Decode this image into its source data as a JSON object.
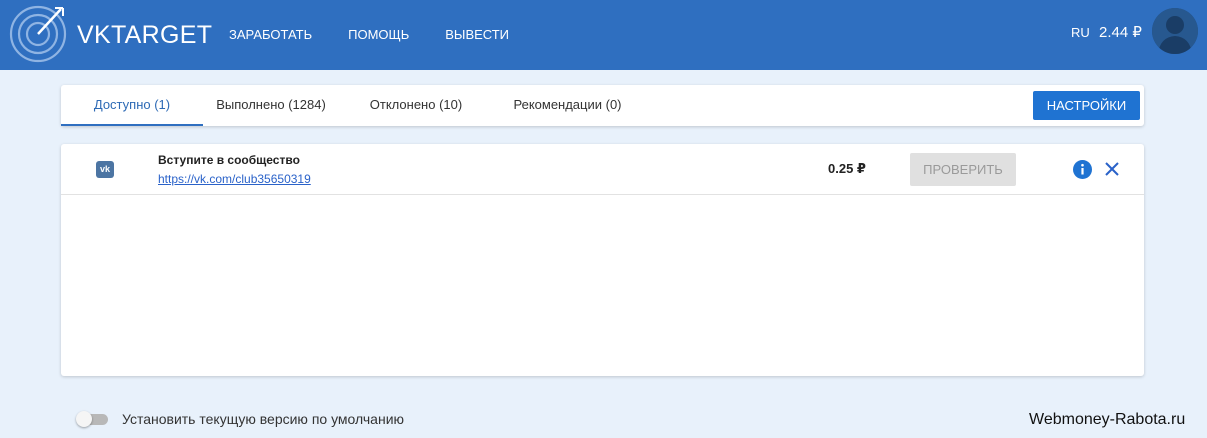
{
  "header": {
    "brand_vk": "VK",
    "brand_target": "TARGET",
    "nav": [
      {
        "label": "ЗАРАБОТАТЬ"
      },
      {
        "label": "ПОМОЩЬ"
      },
      {
        "label": "ВЫВЕСТИ"
      }
    ],
    "lang": "RU",
    "balance": "2.44 ₽",
    "bg_color": "#2f6fc0"
  },
  "tabs": [
    {
      "label": "Доступно (1)",
      "active": true
    },
    {
      "label": "Выполнено (1284)",
      "active": false
    },
    {
      "label": "Отклонено (10)",
      "active": false
    },
    {
      "label": "Рекомендации (0)",
      "active": false
    }
  ],
  "settings_label": "НАСТРОЙКИ",
  "task": {
    "icon": "vk-icon",
    "icon_text": "vk",
    "title": "Вступите в сообщество",
    "link": "https://vk.com/club35650319",
    "price": "0.25 ₽",
    "check_label": "ПРОВЕРИТЬ"
  },
  "footer": {
    "toggle_label": "Установить текущую версию по умолчанию",
    "toggle_on": false,
    "watermark": "Webmoney-Rabota.ru"
  },
  "colors": {
    "accent": "#1f73d2",
    "page_bg": "#e8f1fb",
    "link": "#2a62c9"
  }
}
